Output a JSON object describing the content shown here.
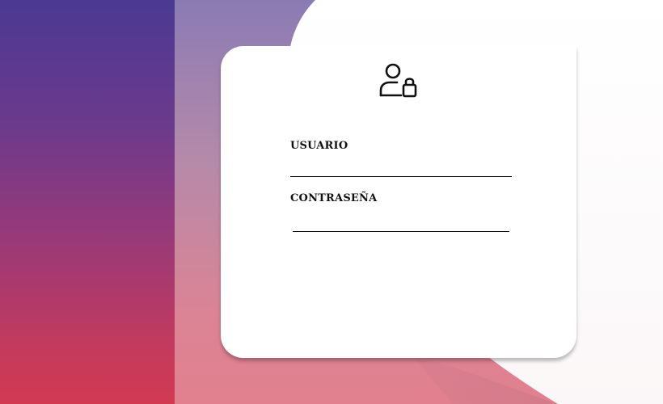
{
  "login": {
    "icon": "user-lock-icon",
    "username_label": "USUARIO",
    "username_value": "",
    "password_label": "CONTRASEÑA",
    "password_value": ""
  },
  "colors": {
    "left_panel_top": "#4a3a92",
    "left_panel_bottom": "#d23a52",
    "card": "#ffffff"
  }
}
